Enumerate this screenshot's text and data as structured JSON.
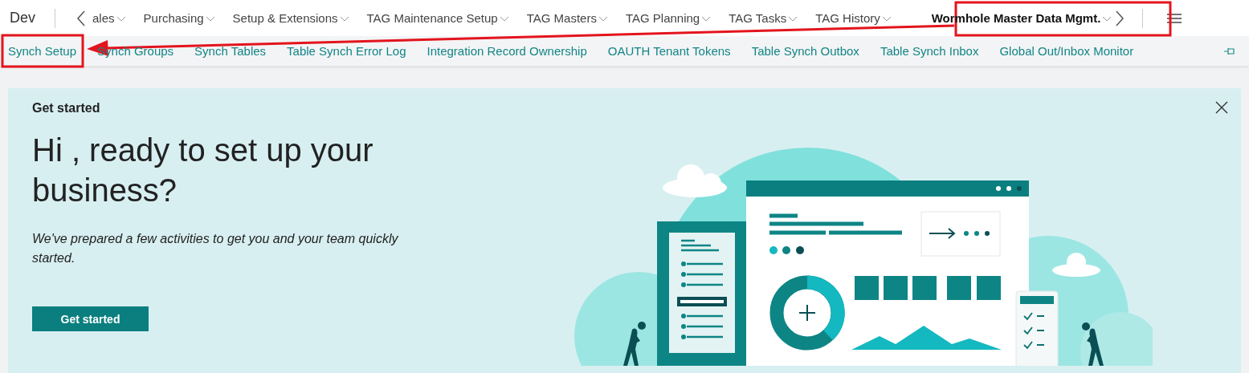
{
  "top_bar": {
    "app_name": "Dev",
    "items": [
      {
        "label": "ales",
        "selected": false
      },
      {
        "label": "Purchasing",
        "selected": false
      },
      {
        "label": "Setup & Extensions",
        "selected": false
      },
      {
        "label": "TAG Maintenance Setup",
        "selected": false
      },
      {
        "label": "TAG Masters",
        "selected": false
      },
      {
        "label": "TAG Planning",
        "selected": false
      },
      {
        "label": "TAG Tasks",
        "selected": false
      },
      {
        "label": "TAG History",
        "selected": false
      },
      {
        "label": "Wormhole Master Data Mgmt.",
        "selected": true
      }
    ]
  },
  "sub_nav": {
    "links": [
      "Synch Setup",
      "Synch Groups",
      "Synch Tables",
      "Table Synch Error Log",
      "Integration Record Ownership",
      "OAUTH Tenant Tokens",
      "Table Synch Outbox",
      "Table Synch Inbox",
      "Global Out/Inbox Monitor"
    ]
  },
  "banner": {
    "eyebrow": "Get started",
    "heading": "Hi , ready to set up your business?",
    "text": "We've prepared a few activities to get you and your team quickly started.",
    "button": "Get started"
  }
}
